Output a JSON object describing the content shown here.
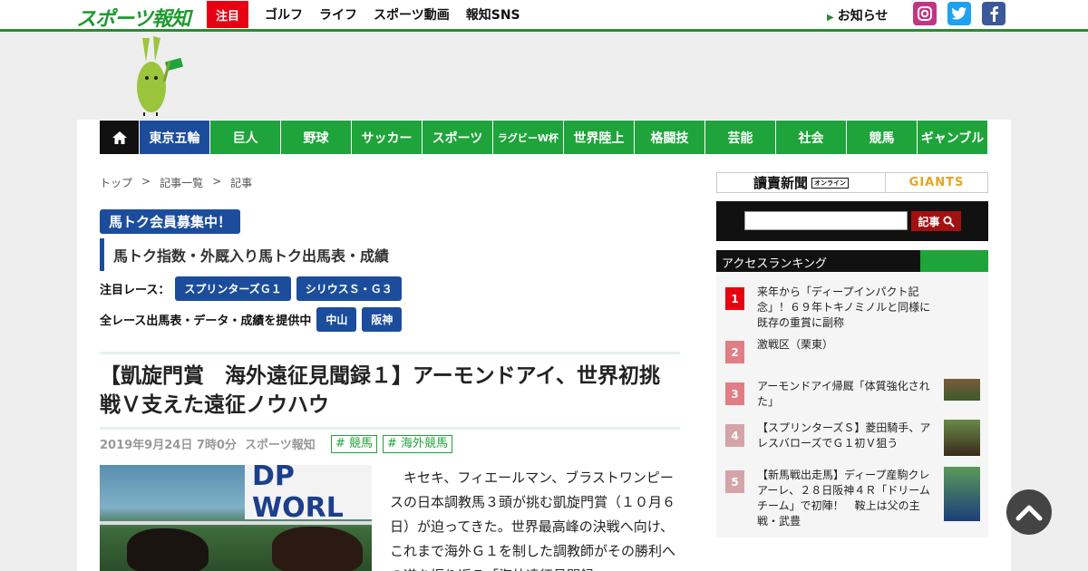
{
  "header": {
    "logo": "スポーツ報知",
    "highlight": "注目",
    "nav": [
      "ゴルフ",
      "ライフ",
      "スポーツ動画",
      "報知SNS"
    ],
    "notice": "お知らせ",
    "sns": [
      "instagram-icon",
      "twitter-icon",
      "facebook-icon"
    ]
  },
  "category_nav": {
    "items": [
      "東京五輪",
      "巨人",
      "野球",
      "サッカー",
      "スポーツ",
      "ラグビーW杯",
      "世界陸上",
      "格闘技",
      "芸能",
      "社会",
      "競馬",
      "ギャンブル"
    ],
    "active": "東京五輪"
  },
  "breadcrumb": [
    "トップ",
    "記事一覧",
    "記事"
  ],
  "umatoku": {
    "badge": "馬トク会員募集中！",
    "subtitle": "馬トク指数・外厩入り馬トク出馬表・成績",
    "featured_label": "注目レース：",
    "featured_races": [
      "スプリンターズＧ１",
      "シリウスＳ・Ｇ３"
    ],
    "all_label": "全レース出馬表・データ・成績を提供中",
    "venues": [
      "中山",
      "阪神"
    ]
  },
  "article": {
    "title": "【凱旋門賞　海外遠征見聞録１】アーモンドアイ、世界初挑戦Ｖ支えた遠征ノウハウ",
    "date": "2019年9月24日 7時0分",
    "source": "スポーツ報知",
    "tags": [
      "# 競馬",
      "# 海外競馬"
    ],
    "photo_banner": "DP WORL",
    "body": "キセキ、フィエールマン、ブラストワンピースの日本調教馬３頭が挑む凱旋門賞（１０月６日）が迫ってきた。世界最高峰の決戦へ向け、これまで海外Ｇ１を制した調教師がその勝利への道を振り返る「海外遠征見聞録"
  },
  "sidebar": {
    "partner_left": "讀賣新聞",
    "partner_left_tag": "オンライン",
    "partner_right": "GIANTS",
    "search_button": "記事",
    "ranking_title": "アクセスランキング",
    "ranking": [
      {
        "rank": "1",
        "text": "来年から「ディープインパクト記念」！６９年トキノミノルと同様に既存の重賞に副称",
        "color": "#e60012"
      },
      {
        "rank": "2",
        "text": "激戦区（栗東）",
        "color": "#e07d85"
      },
      {
        "rank": "3",
        "text": "アーモンドアイ帰厩「体質強化された」",
        "color": "#e07d85"
      },
      {
        "rank": "4",
        "text": "【スプリンターズＳ】菱田騎手、アレスバローズでＧ１初Ｖ狙う",
        "color": "#d4a4a8"
      },
      {
        "rank": "5",
        "text": "【新馬戦出走馬】ディープ産駒クレアーレ、２８日阪神４Ｒ「ドリームチーム」で初陣！　鞍上は父の主戦・武豊",
        "color": "#d4a4a8"
      }
    ]
  },
  "colors": {
    "brand_green": "#1ea43a",
    "brand_blue": "#1c4d9c",
    "accent_red": "#e60012"
  }
}
